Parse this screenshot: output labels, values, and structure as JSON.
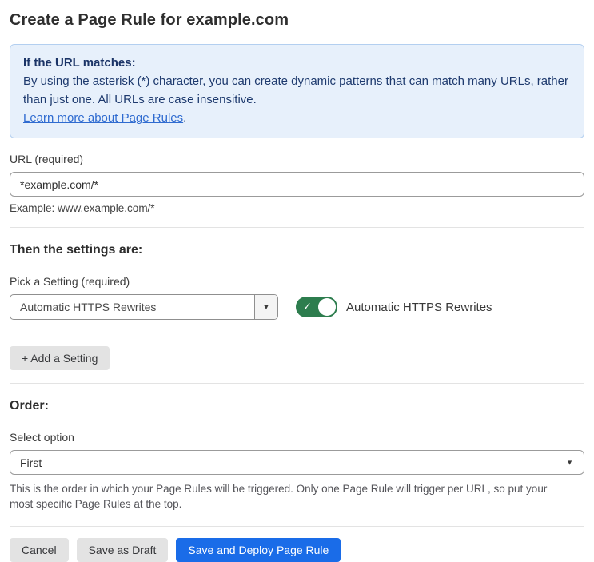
{
  "page": {
    "title": "Create a Page Rule for example.com"
  },
  "info_box": {
    "heading": "If the URL matches:",
    "body": "By using the asterisk (*) character, you can create dynamic patterns that can match many URLs, rather than just one. All URLs are case insensitive.",
    "link_label": "Learn more about Page Rules",
    "link_suffix": "."
  },
  "url_field": {
    "label": "URL (required)",
    "value": "*example.com/*",
    "helper": "Example: www.example.com/*"
  },
  "settings_section": {
    "heading": "Then the settings are:",
    "pick_label": "Pick a Setting (required)",
    "selected_setting": "Automatic HTTPS Rewrites",
    "toggle_state": "on",
    "toggle_label": "Automatic HTTPS Rewrites",
    "add_setting_label": "+ Add a Setting"
  },
  "order_section": {
    "heading": "Order:",
    "select_label": "Select option",
    "selected_option": "First",
    "helper": "This is the order in which your Page Rules will be triggered. Only one Page Rule will trigger per URL, so put your most specific Page Rules at the top."
  },
  "footer": {
    "cancel_label": "Cancel",
    "save_draft_label": "Save as Draft",
    "save_deploy_label": "Save and Deploy Page Rule"
  },
  "icons": {
    "dropdown_caret": "▼",
    "select_caret": "▼",
    "toggle_check": "✓"
  },
  "colors": {
    "accent_blue": "#1a6ce8",
    "toggle_green": "#2d7d4e",
    "info_bg": "#e7f0fb",
    "info_border": "#b3cff0",
    "info_text": "#1e3a6e",
    "link_blue": "#2f6bd0"
  }
}
